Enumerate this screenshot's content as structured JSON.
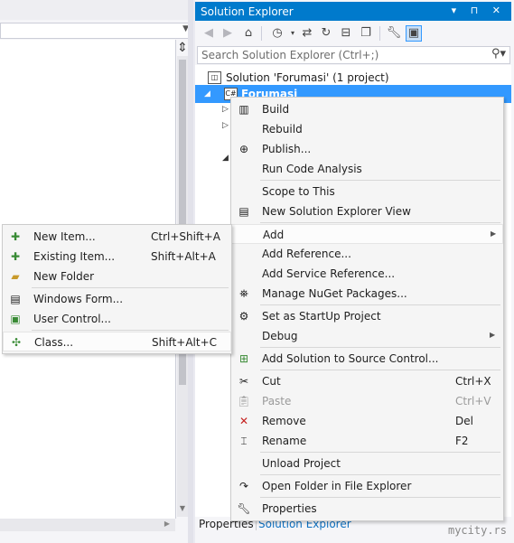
{
  "solution_explorer": {
    "title": "Solution Explorer",
    "title_buttons": "▾ ⊓ ✕",
    "search_placeholder": "Search Solution Explorer (Ctrl+;)",
    "tree": {
      "solution_label": "Solution 'Forumasi' (1 project)",
      "project_label": "Forumasi"
    },
    "tabs": [
      "Properties",
      "Solution Explorer"
    ]
  },
  "watermark": "mycity.rs",
  "context_menu": {
    "items": [
      {
        "label": "Build",
        "shortcut": "",
        "icon": "build-icon"
      },
      {
        "label": "Rebuild",
        "shortcut": "",
        "icon": ""
      },
      {
        "label": "Publish...",
        "shortcut": "",
        "icon": "publish-icon"
      },
      {
        "label": "Run Code Analysis",
        "shortcut": "",
        "icon": ""
      },
      {
        "label": "Scope to This",
        "shortcut": "",
        "icon": ""
      },
      {
        "label": "New Solution Explorer View",
        "shortcut": "",
        "icon": "new-view-icon"
      },
      {
        "label": "Add",
        "shortcut": "",
        "icon": ""
      },
      {
        "label": "Add Reference...",
        "shortcut": "",
        "icon": ""
      },
      {
        "label": "Add Service Reference...",
        "shortcut": "",
        "icon": ""
      },
      {
        "label": "Manage NuGet Packages...",
        "shortcut": "",
        "icon": "nuget-icon"
      },
      {
        "label": "Set as StartUp Project",
        "shortcut": "",
        "icon": "gear-icon"
      },
      {
        "label": "Debug",
        "shortcut": "",
        "icon": ""
      },
      {
        "label": "Add Solution to Source Control...",
        "shortcut": "",
        "icon": "source-control-icon"
      },
      {
        "label": "Cut",
        "shortcut": "Ctrl+X",
        "icon": "scissors-icon"
      },
      {
        "label": "Paste",
        "shortcut": "Ctrl+V",
        "icon": "clipboard-icon"
      },
      {
        "label": "Remove",
        "shortcut": "Del",
        "icon": "remove-icon"
      },
      {
        "label": "Rename",
        "shortcut": "F2",
        "icon": "rename-icon"
      },
      {
        "label": "Unload Project",
        "shortcut": "",
        "icon": ""
      },
      {
        "label": "Open Folder in File Explorer",
        "shortcut": "",
        "icon": "refresh-arrow-icon"
      },
      {
        "label": "Properties",
        "shortcut": "",
        "icon": "wrench-icon"
      }
    ]
  },
  "add_submenu": {
    "items": [
      {
        "label": "New Item...",
        "shortcut": "Ctrl+Shift+A"
      },
      {
        "label": "Existing Item...",
        "shortcut": "Shift+Alt+A"
      },
      {
        "label": "New Folder",
        "shortcut": ""
      },
      {
        "label": "Windows Form...",
        "shortcut": ""
      },
      {
        "label": "User Control...",
        "shortcut": ""
      },
      {
        "label": "Class...",
        "shortcut": "Shift+Alt+C"
      }
    ]
  }
}
